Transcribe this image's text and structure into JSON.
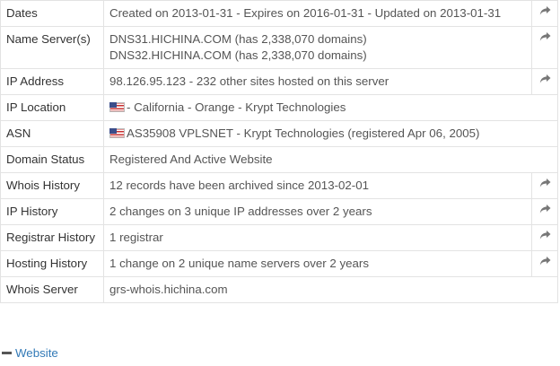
{
  "rows": [
    {
      "label": "Dates",
      "value": "Created on 2013-01-31 - Expires on 2016-01-31 - Updated on 2013-01-31",
      "action": true
    },
    {
      "label": "Name Server(s)",
      "lines": [
        "DNS31.HICHINA.COM (has 2,338,070 domains)",
        "DNS32.HICHINA.COM (has 2,338,070 domains)"
      ],
      "action": true
    },
    {
      "label": "IP Address",
      "value": "98.126.95.123 - 232 other sites hosted on this server",
      "action": true
    },
    {
      "label": "IP Location",
      "value": "- California - Orange - Krypt Technologies",
      "flag": "us-flag",
      "action": false
    },
    {
      "label": "ASN",
      "value": "AS35908 VPLSNET - Krypt Technologies (registered Apr 06, 2005)",
      "flag": "us-flag",
      "action": false
    },
    {
      "label": "Domain Status",
      "value": "Registered And Active Website",
      "action": false
    },
    {
      "label": "Whois History",
      "value": "12 records have been archived since 2013-02-01",
      "action": true
    },
    {
      "label": "IP History",
      "value": "2 changes on 3 unique IP addresses over 2 years",
      "action": true
    },
    {
      "label": "Registrar History",
      "value": "1 registrar",
      "action": true
    },
    {
      "label": "Hosting History",
      "value": "1 change on 2 unique name servers over 2 years",
      "action": true
    },
    {
      "label": "Whois Server",
      "value": "grs-whois.hichina.com",
      "action": false
    }
  ],
  "website_section": {
    "label": "Website",
    "icon": "minus-icon"
  },
  "icons": {
    "action": "share-arrow-icon",
    "flag": "us-flag-icon"
  },
  "colors": {
    "border": "#e3e3e3",
    "label": "#333333",
    "value": "#555555",
    "link": "#337ab7",
    "icon": "#777777"
  }
}
